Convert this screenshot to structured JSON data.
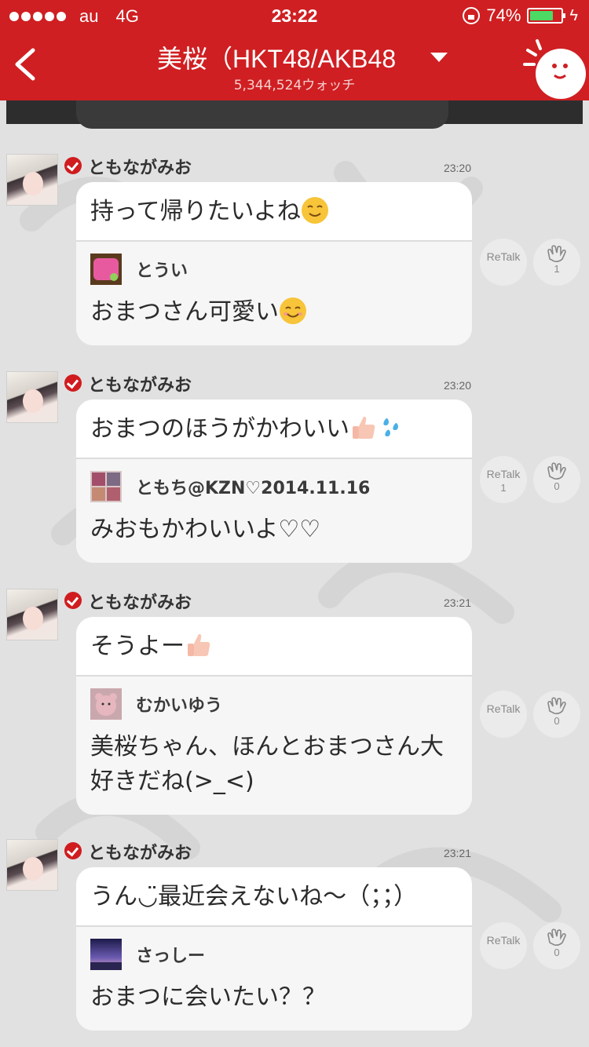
{
  "status_bar": {
    "carrier": "au",
    "network": "4G",
    "time": "23:22",
    "battery": "74%",
    "battery_level": 0.74
  },
  "nav": {
    "title": "美桜（HKT48/AKB48",
    "subtitle": "5,344,524ウォッチ",
    "accent_color": "#cf1f22"
  },
  "posts": [
    {
      "author": "ともながみお",
      "time": "23:20",
      "message": "持って帰りたいよね",
      "message_emoji": "smiling-face-emoji",
      "quote_author": "とうい",
      "quote_text": "おまつさん可愛い",
      "quote_emoji": "smiling-face-emoji",
      "retalk_label": "ReTalk",
      "retalk_count": "",
      "clap_count": "1"
    },
    {
      "author": "ともながみお",
      "time": "23:20",
      "message": "おまつのほうがかわいい",
      "message_emoji": "thumbs-up-and-sweat-emoji",
      "quote_author": "ともち@KZN♡2014.11.16",
      "quote_text": "みおもかわいいよ♡♡",
      "quote_emoji": "",
      "retalk_label": "ReTalk",
      "retalk_count": "1",
      "clap_count": "0"
    },
    {
      "author": "ともながみお",
      "time": "23:21",
      "message": "そうよー",
      "message_emoji": "thumbs-up-emoji",
      "quote_author": "むかいゆう",
      "quote_text": "美桜ちゃん、ほんとおまつさん大好きだね(>_<)",
      "quote_emoji": "",
      "retalk_label": "ReTalk",
      "retalk_count": "",
      "clap_count": "0"
    },
    {
      "author": "ともながみお",
      "time": "23:21",
      "message": "うん◡̈最近会えないね〜（；；）",
      "message_emoji": "",
      "quote_author": "さっしー",
      "quote_text": "おまつに会いたい？？",
      "quote_emoji": "",
      "retalk_label": "ReTalk",
      "retalk_count": "",
      "clap_count": "0"
    }
  ]
}
